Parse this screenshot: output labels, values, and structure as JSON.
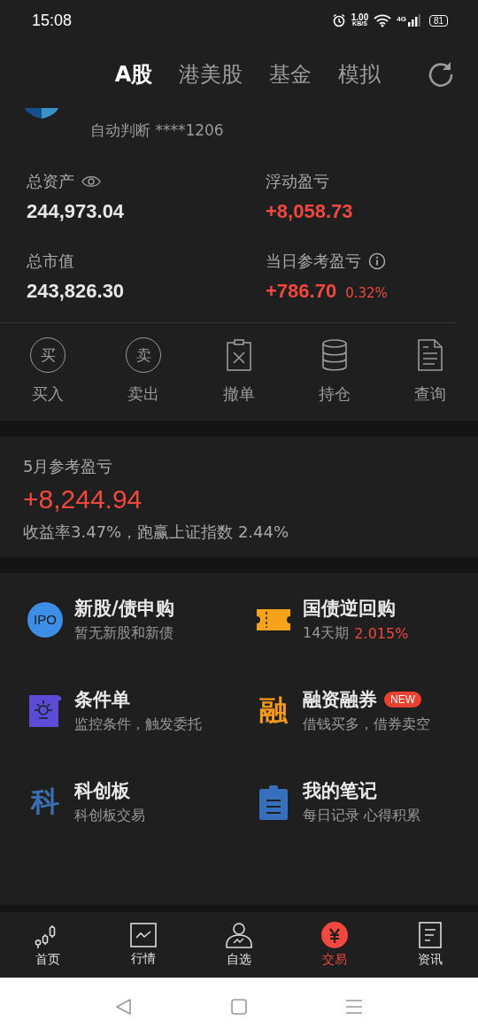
{
  "status_bar": {
    "time": "15:08",
    "speed": "1.00",
    "speed_unit": "KB/S",
    "network": "4G",
    "battery": "81"
  },
  "tabs": [
    {
      "label": "A股",
      "selected": true
    },
    {
      "label": "港美股",
      "selected": false
    },
    {
      "label": "基金",
      "selected": false
    },
    {
      "label": "模拟",
      "selected": false
    }
  ],
  "account": {
    "mode": "自动判断 ****1206"
  },
  "assets": [
    {
      "label": "总资产",
      "value": "244,973.04",
      "color": "#e8e8e8"
    },
    {
      "label": "浮动盈亏",
      "value": "+8,058.73",
      "color": "#f0483e"
    },
    {
      "label": "总市值",
      "value": "243,826.30",
      "color": "#e8e8e8"
    },
    {
      "label": "当日参考盈亏",
      "value": "+786.70",
      "percent": "0.32%",
      "color": "#f0483e"
    }
  ],
  "actions": [
    {
      "label": "买入",
      "icon_char": "买"
    },
    {
      "label": "卖出",
      "icon_char": "卖"
    },
    {
      "label": "撤单"
    },
    {
      "label": "持仓"
    },
    {
      "label": "查询"
    }
  ],
  "monthly": {
    "title": "5月参考盈亏",
    "value": "+8,244.94",
    "summary": "收益率3.47%，跑赢上证指数 2.44%"
  },
  "services": [
    {
      "title": "新股/债申购",
      "subtitle": "暂无新股和新债",
      "icon_text": "IPO"
    },
    {
      "title": "国债逆回购",
      "subtitle": "14天期",
      "highlight": "2.015%"
    },
    {
      "title": "条件单",
      "subtitle": "监控条件，触发委托"
    },
    {
      "title": "融资融券",
      "subtitle": "借钱买多，借券卖空",
      "icon_text": "融",
      "badge": "NEW"
    },
    {
      "title": "科创板",
      "subtitle": "科创板交易",
      "icon_text": "科"
    },
    {
      "title": "我的笔记",
      "subtitle": "每日记录 心得积累"
    }
  ],
  "bottom_nav": [
    {
      "label": "首页",
      "selected": false
    },
    {
      "label": "行情",
      "selected": false
    },
    {
      "label": "自选",
      "selected": false
    },
    {
      "label": "交易",
      "selected": true
    },
    {
      "label": "资讯",
      "selected": false
    }
  ]
}
